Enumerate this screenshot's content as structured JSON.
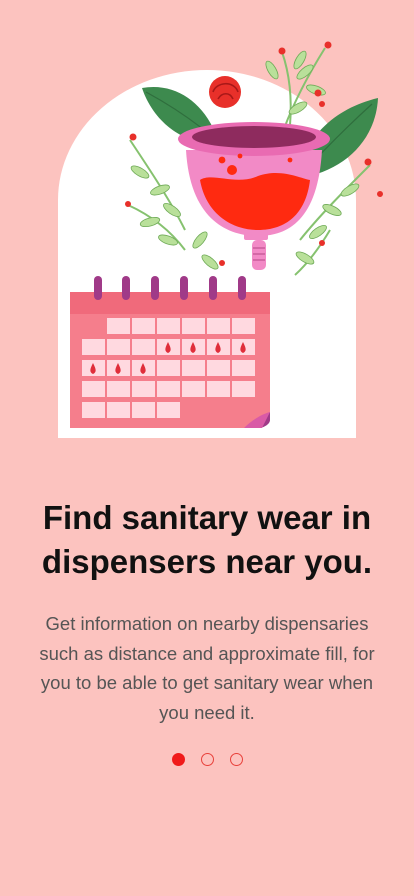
{
  "onboarding": {
    "title": "Find sanitary wear in dispensers near you.",
    "description": "Get information on nearby dispensaries such as distance and approximate fill, for you to be able to get sanitary wear when you need it.",
    "current_page": 1,
    "total_pages": 3
  },
  "illustration": {
    "icon": "menstrual-cup-calendar-illustration"
  },
  "colors": {
    "background": "#fcc3bf",
    "accent": "#f01a1a",
    "title": "#111111",
    "body_text": "#555555"
  }
}
